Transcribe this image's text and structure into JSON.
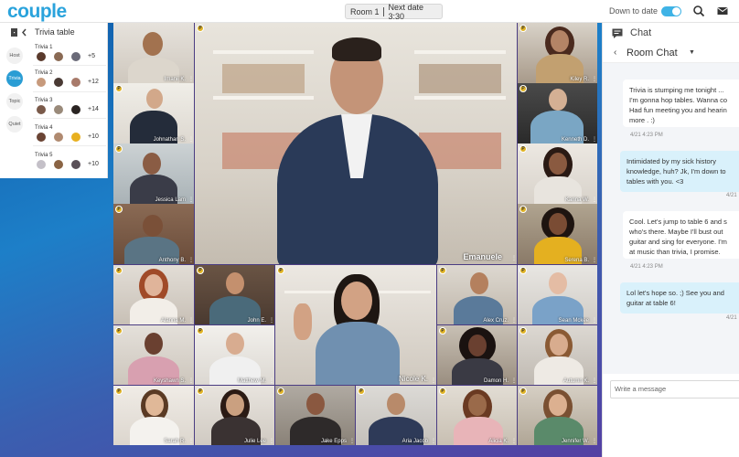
{
  "app": {
    "logo": "couple"
  },
  "topbar": {
    "room": "Room 1",
    "next_date": "Next date 3:30",
    "down_to_date": "Down to date",
    "toggle_on": true,
    "icons": [
      "search-icon",
      "mail-icon"
    ]
  },
  "trivia": {
    "title": "Trivia table",
    "side_buttons": [
      {
        "label": "Host",
        "active": false
      },
      {
        "label": "Trivia",
        "active": true
      },
      {
        "label": "Topic",
        "active": false
      },
      {
        "label": "Quiet",
        "active": false
      }
    ],
    "tables": [
      {
        "label": "Trivia 1",
        "more": "+5"
      },
      {
        "label": "Trivia 2",
        "more": "+12"
      },
      {
        "label": "Trivia 3",
        "more": "+14"
      },
      {
        "label": "Trivia 4",
        "more": "+10"
      },
      {
        "label": "Trivia 5",
        "more": "+10"
      }
    ]
  },
  "participants": [
    {
      "name": "Imanii K."
    },
    {
      "name": "Johnathan S."
    },
    {
      "name": "Jessica Lam"
    },
    {
      "name": "Anthony B."
    },
    {
      "name": "Emanuele"
    },
    {
      "name": "Kiley R."
    },
    {
      "name": "Kenneth D."
    },
    {
      "name": "Karina W."
    },
    {
      "name": "Serena B."
    },
    {
      "name": "Alanna M."
    },
    {
      "name": "John E."
    },
    {
      "name": "Nicole K."
    },
    {
      "name": "Alex Cruz."
    },
    {
      "name": "Sean Mckee"
    },
    {
      "name": "Keyshawn S."
    },
    {
      "name": "Matthew M."
    },
    {
      "name": "Damon H."
    },
    {
      "name": "Autumn K."
    },
    {
      "name": "Sarah R."
    },
    {
      "name": "Julie Lee"
    },
    {
      "name": "Jake Epps"
    },
    {
      "name": "Aria Jacob"
    },
    {
      "name": "Alicia K."
    },
    {
      "name": "Jennifer W."
    }
  ],
  "chat": {
    "title": "Chat",
    "room": "Room Chat",
    "messages": [
      {
        "dir": "in",
        "text": "Trivia is stumping me tonight ...\nI'm gonna hop tables. Wanna co\nHad fun meeting you and hearin\nmore . :)",
        "time": "4/21 4:23 PM"
      },
      {
        "dir": "out",
        "text": "Intimidated by my sick history\nknowledge, huh? Jk, I'm down to\ntables with you. <3",
        "time": "4/21"
      },
      {
        "dir": "in",
        "text": "Cool. Let's jump to table 6 and s\nwho's there. Maybe I'll bust out\nguitar and sing for everyone. I'm\nat music than trivia, I promise.",
        "time": "4/21 4:23 PM"
      },
      {
        "dir": "out",
        "text": "Lol let's hope so. ;) See you and\nguitar at table 6!",
        "time": "4/21"
      }
    ],
    "placeholder": "Write a message"
  }
}
